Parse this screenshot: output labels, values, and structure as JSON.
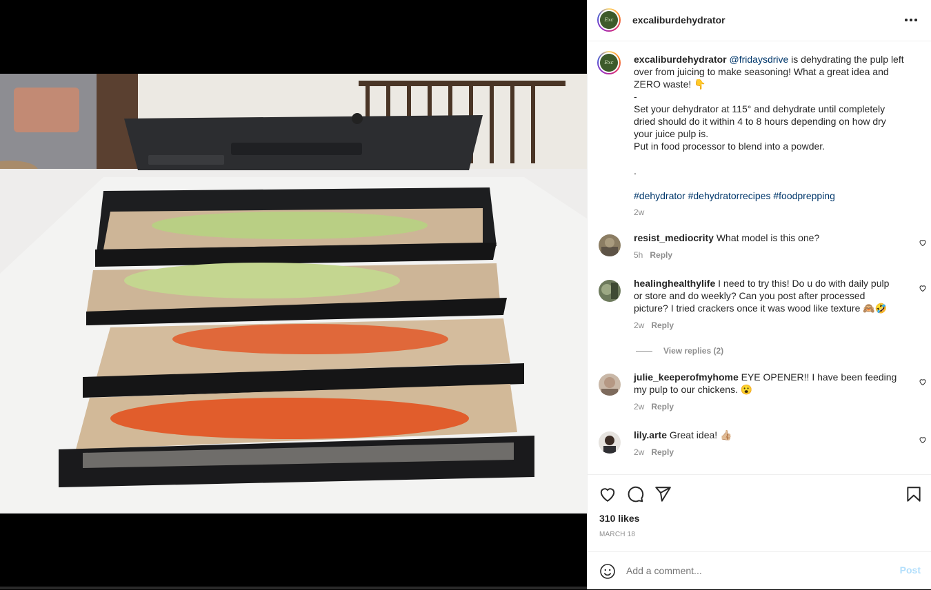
{
  "post": {
    "username": "excaliburdehydrator",
    "brand_color": "#3d5a2a"
  },
  "caption": {
    "username": "excaliburdehydrator",
    "mention": "@fridaysdrive",
    "text_1": " is dehydrating the pulp left over from juicing to make seasoning! What a great idea and ZERO waste! 👇",
    "dash": "-",
    "text_2": "Set your dehydrator at 115° and dehydrate until completely dried should do it within 4 to 8 hours depending on how dry your juice pulp is.",
    "text_3": "Put in food processor to blend into a powder.",
    "dot": ".",
    "hashtags": [
      "#dehydrator",
      "#dehydratorrecipes",
      "#foodprepping"
    ],
    "age": "2w"
  },
  "comments": [
    {
      "username": "resist_mediocrity",
      "text": "What model is this one?",
      "age": "5h",
      "reply": "Reply"
    },
    {
      "username": "healinghealthylife",
      "text": "I need to try this! Do u do with daily pulp or store and do weekly? Can you post after processed picture? I tried crackers once it was wood like texture 🙈🤣",
      "age": "2w",
      "reply": "Reply"
    },
    {
      "username": "julie_keeperofmyhome",
      "text": "EYE OPENER!! I have been feeding my pulp to our chickens. 😮",
      "age": "2w",
      "reply": "Reply"
    },
    {
      "username": "lily.arte",
      "text": "Great idea! 👍🏼",
      "age": "2w",
      "reply": "Reply"
    }
  ],
  "view_replies": "View replies (2)",
  "actions": {
    "likes": "310 likes",
    "date": "MARCH 18"
  },
  "add_comment": {
    "placeholder": "Add a comment...",
    "post_label": "Post"
  },
  "icons": [
    "more-options-icon",
    "heart-icon",
    "comment-icon",
    "share-icon",
    "bookmark-icon",
    "emoji-icon"
  ]
}
